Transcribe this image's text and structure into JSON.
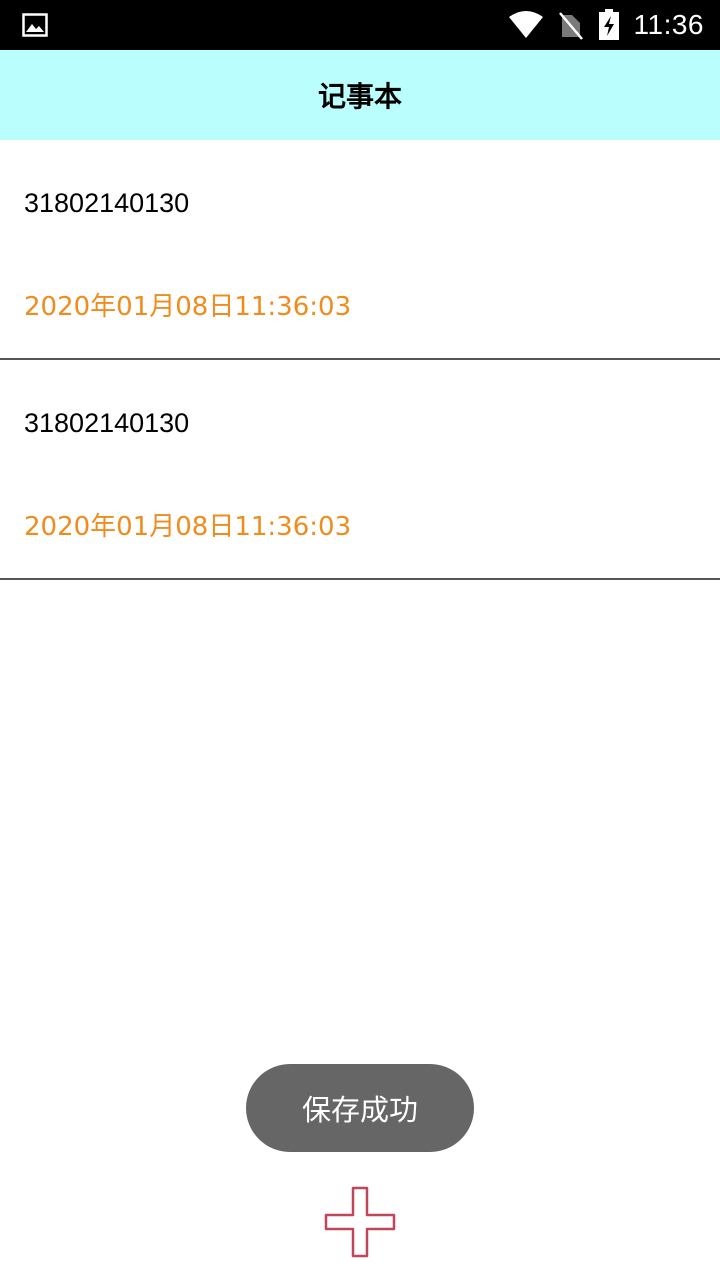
{
  "status_bar": {
    "time": "11:36",
    "icons": [
      "image-icon",
      "wifi-icon",
      "no-sim-icon",
      "battery-charging-icon"
    ]
  },
  "app_bar": {
    "title": "记事本"
  },
  "notes": [
    {
      "title": "31802140130",
      "time": "2020年01月08日11:36:03"
    },
    {
      "title": "31802140130",
      "time": "2020年01月08日11:36:03"
    }
  ],
  "toast": {
    "message": "保存成功"
  },
  "fab": {
    "icon": "add-icon"
  },
  "colors": {
    "status_bar": "#000000",
    "app_bar": "#bbfefe",
    "note_time": "#f08c1e",
    "toast_bg": "#666666",
    "add_icon_stroke": "#c0465a"
  }
}
